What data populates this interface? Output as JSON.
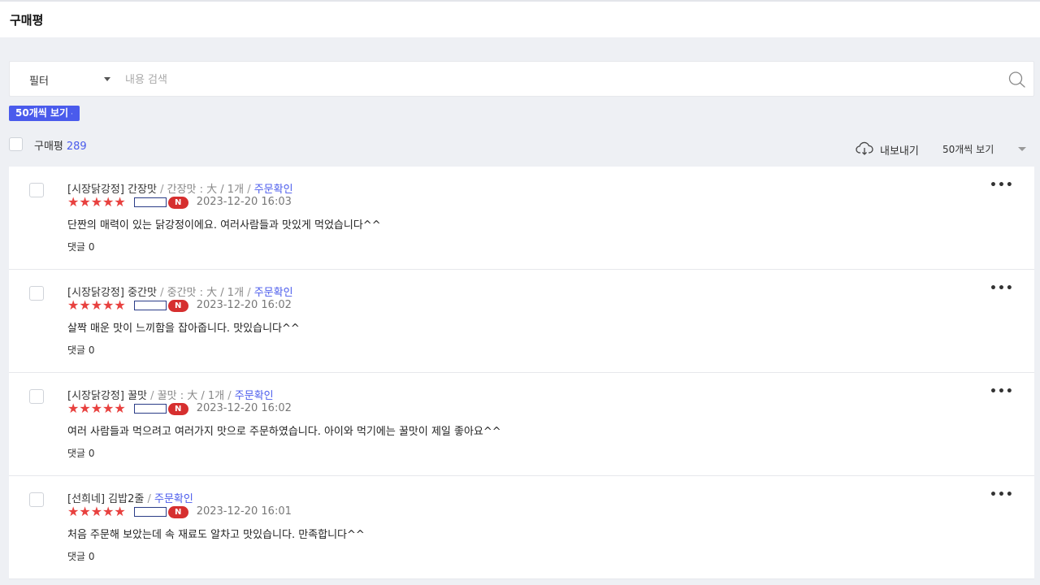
{
  "header": {
    "title": "구매평"
  },
  "filter": {
    "select_label": "필터",
    "search_placeholder": "내용 검색"
  },
  "chip": {
    "label": "50개씩 보기",
    "remove": "·"
  },
  "summary": {
    "label": "구매평",
    "count": "289"
  },
  "toolbar": {
    "export_label": "내보내기",
    "per_page_label": "50개씩 보기"
  },
  "colors": {
    "accent": "#4a5bec",
    "star": "#e8413f",
    "badge": "#d62f2f"
  },
  "icons": {
    "search": "search-icon",
    "export": "cloud-download-icon",
    "more": "more-horizontal-icon"
  },
  "reviews": [
    {
      "product": "[시장닭강정] 간장맛",
      "option": "간장맛 : 大 / 1개",
      "status": "주문확인",
      "rating": 5,
      "stars": "★★★★★",
      "badge": "N",
      "date": "2023-12-20 16:03",
      "text": "단짠의 매력이 있는 닭강정이에요. 여러사람들과 맛있게 먹었습니다^^",
      "reply": "댓글 0"
    },
    {
      "product": "[시장닭강정] 중간맛",
      "option": "중간맛 : 大 / 1개",
      "status": "주문확인",
      "rating": 5,
      "stars": "★★★★★",
      "badge": "N",
      "date": "2023-12-20 16:02",
      "text": "살짝 매운 맛이 느끼함을 잡아줍니다. 맛있습니다^^",
      "reply": "댓글 0"
    },
    {
      "product": "[시장닭강정] 꿀맛",
      "option": "꿀맛 : 大 / 1개",
      "status": "주문확인",
      "rating": 5,
      "stars": "★★★★★",
      "badge": "N",
      "date": "2023-12-20 16:02",
      "text": "여러 사람들과 먹으려고 여러가지 맛으로 주문하였습니다. 아이와 먹기에는 꿀맛이 제일 좋아요^^",
      "reply": "댓글 0"
    },
    {
      "product": "[선희네] 김밥2줄",
      "option": "",
      "status": "주문확인",
      "rating": 5,
      "stars": "★★★★★",
      "badge": "N",
      "date": "2023-12-20 16:01",
      "text": "처음 주문해 보았는데 속 재료도 알차고 맛있습니다. 만족합니다^^",
      "reply": "댓글 0"
    }
  ]
}
